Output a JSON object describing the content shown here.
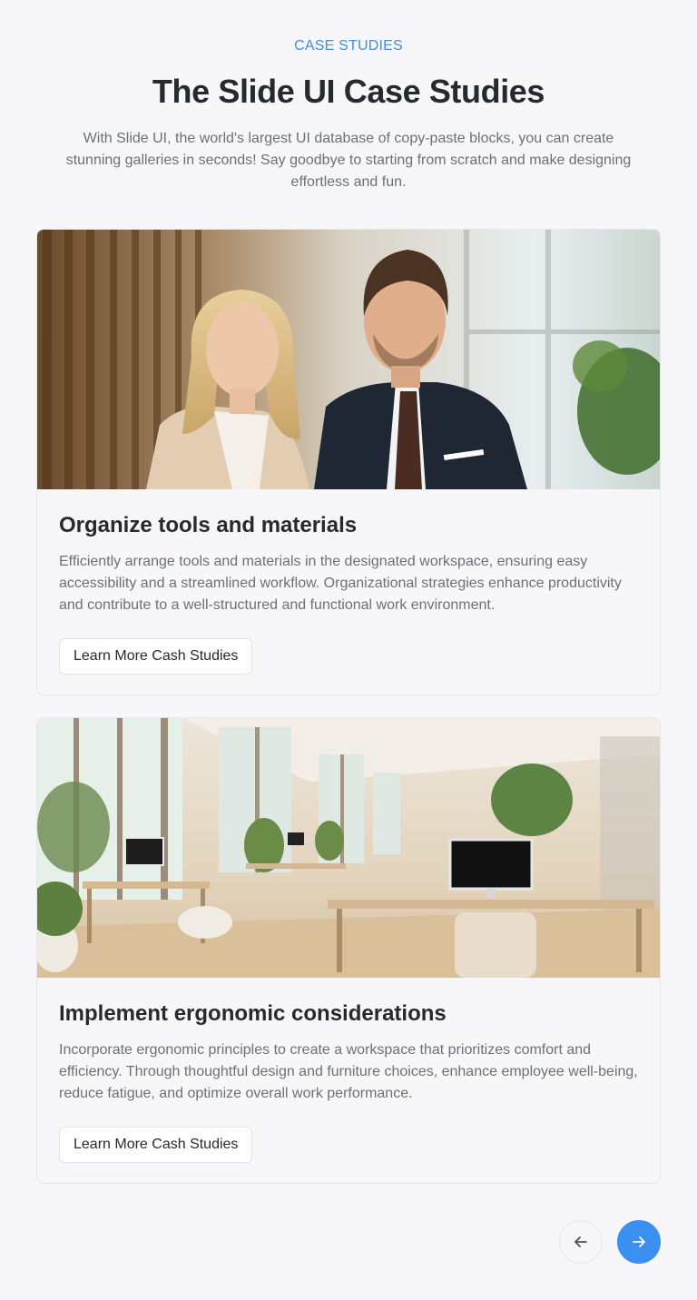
{
  "header": {
    "eyebrow": "CASE STUDIES",
    "title": "The Slide UI Case Studies",
    "subtitle": "With Slide UI, the world's largest UI database of copy-paste blocks, you can create stunning galleries in seconds! Say goodbye to starting from scratch and make designing effortless and fun."
  },
  "cards": [
    {
      "image_subject": "two-business-people-photo",
      "title": "Organize tools and materials",
      "text": "Efficiently arrange tools and materials in the designated workspace, ensuring easy accessibility and a streamlined workflow. Organizational strategies enhance productivity and contribute to a well-structured and functional work environment.",
      "button_label": "Learn More Cash Studies"
    },
    {
      "image_subject": "office-workspace-photo",
      "title": "Implement ergonomic considerations",
      "text": "Incorporate ergonomic principles to create a workspace that prioritizes comfort and efficiency. Through thoughtful design and furniture choices, enhance employee well-being, reduce fatigue, and optimize overall work performance.",
      "button_label": "Learn More Cash Studies"
    }
  ],
  "navigation": {
    "prev_icon": "arrow-left-icon",
    "next_icon": "arrow-right-icon"
  },
  "colors": {
    "accent": "#3b8ff0",
    "eyebrow": "#3f8fe3",
    "background": "#f7f7f9"
  }
}
